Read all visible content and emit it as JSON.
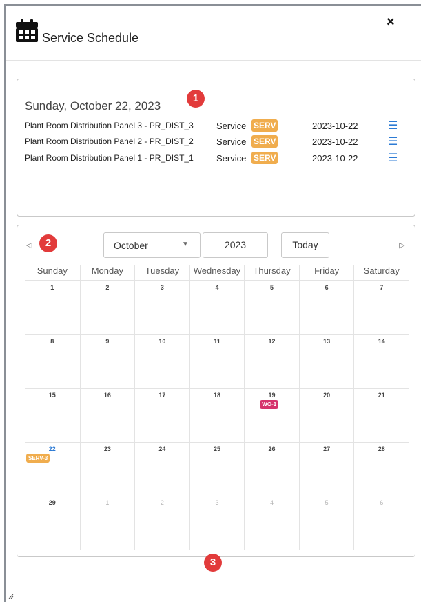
{
  "dialog": {
    "title": "Service Schedule",
    "close_label": "×"
  },
  "day_panel": {
    "date_heading": "Sunday, October 22, 2023",
    "events": [
      {
        "name": "Plant Room Distribution Panel 3 - PR_DIST_3",
        "type": "Service",
        "badge": "SERV",
        "date": "2023-10-22",
        "menu": "☰"
      },
      {
        "name": "Plant Room Distribution Panel 2 - PR_DIST_2",
        "type": "Service",
        "badge": "SERV",
        "date": "2023-10-22",
        "menu": "☰"
      },
      {
        "name": "Plant Room Distribution Panel 1 - PR_DIST_1",
        "type": "Service",
        "badge": "SERV",
        "date": "2023-10-22",
        "menu": "☰"
      }
    ]
  },
  "markers": [
    "1",
    "2",
    "3"
  ],
  "calendar": {
    "prev_arrow": "◁",
    "next_arrow": "▷",
    "month": "October",
    "caret": "▼",
    "year": "2023",
    "today_label": "Today",
    "weekdays": [
      "Sunday",
      "Monday",
      "Tuesday",
      "Wednesday",
      "Thursday",
      "Friday",
      "Saturday"
    ],
    "weeks": [
      [
        {
          "d": "1"
        },
        {
          "d": "2"
        },
        {
          "d": "3"
        },
        {
          "d": "4"
        },
        {
          "d": "5"
        },
        {
          "d": "6"
        },
        {
          "d": "7"
        }
      ],
      [
        {
          "d": "8"
        },
        {
          "d": "9"
        },
        {
          "d": "10"
        },
        {
          "d": "11"
        },
        {
          "d": "12"
        },
        {
          "d": "13"
        },
        {
          "d": "14"
        }
      ],
      [
        {
          "d": "15"
        },
        {
          "d": "16"
        },
        {
          "d": "17"
        },
        {
          "d": "18"
        },
        {
          "d": "19",
          "event": "WO-1",
          "event_color": "#d6336c"
        },
        {
          "d": "20"
        },
        {
          "d": "21"
        }
      ],
      [
        {
          "d": "22",
          "today": true,
          "event": "SERV-3",
          "event_color": "#f0ad4e"
        },
        {
          "d": "23"
        },
        {
          "d": "24"
        },
        {
          "d": "25"
        },
        {
          "d": "26"
        },
        {
          "d": "27"
        },
        {
          "d": "28"
        }
      ],
      [
        {
          "d": "29"
        },
        {
          "d": "1",
          "other": true
        },
        {
          "d": "2",
          "other": true
        },
        {
          "d": "3",
          "other": true
        },
        {
          "d": "4",
          "other": true
        },
        {
          "d": "5",
          "other": true
        },
        {
          "d": "6",
          "other": true
        }
      ]
    ]
  },
  "colors": {
    "accent": "#2d7bd4",
    "service_badge": "#f0ad4e",
    "work_order": "#d6336c",
    "marker": "#e23b3b"
  },
  "icons": {
    "header": "calendar-icon",
    "close": "close-icon",
    "menu": "hamburger-menu-icon",
    "prev": "triangle-left-icon",
    "next": "triangle-right-icon",
    "caret": "caret-down-icon",
    "grip": "resize-grip-icon"
  }
}
